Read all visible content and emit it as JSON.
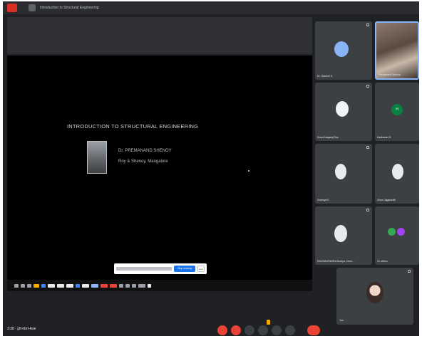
{
  "window": {
    "tab_title": "Introduction to Structural Engineering"
  },
  "slide": {
    "title": "INTRODUCTION TO STRUCTURAL ENGINEERING",
    "presenter_name": "Dr. PREMANAND SHENOY",
    "presenter_affiliation": "Roy & Shenoy, Mangalore"
  },
  "share_bar": {
    "message": "",
    "stop_label": "Stop sharing",
    "hide_label": "Hide"
  },
  "participants": [
    {
      "name": "Dr. Ganesh S.",
      "avatar_color": "#8ab4f8"
    },
    {
      "name": "Premanand Shenoy",
      "avatar_color": ""
    },
    {
      "name": "Surya Nagaraj Rao",
      "avatar_color": "#f1f3f4"
    },
    {
      "name": "Hariharan M",
      "initial": "H",
      "avatar_color": "#0b8043"
    },
    {
      "name": "Sowmya K",
      "avatar_color": "#e8eaed"
    },
    {
      "name": "Vinod Jagannath",
      "avatar_color": "#e8eaed"
    },
    {
      "name": "RAGHAVENDRA Moolya, Chen...",
      "avatar_color": "#e8eaed"
    },
    {
      "name": "10 others",
      "avatar_color": "#34a853"
    }
  ],
  "self_view": {
    "name": "You"
  },
  "controls": {
    "meeting_time": "3:38 · gtf-nbrt-kwe"
  },
  "colors": {
    "danger": "#ea4335",
    "accent": "#1a73e8",
    "background": "#202124"
  }
}
